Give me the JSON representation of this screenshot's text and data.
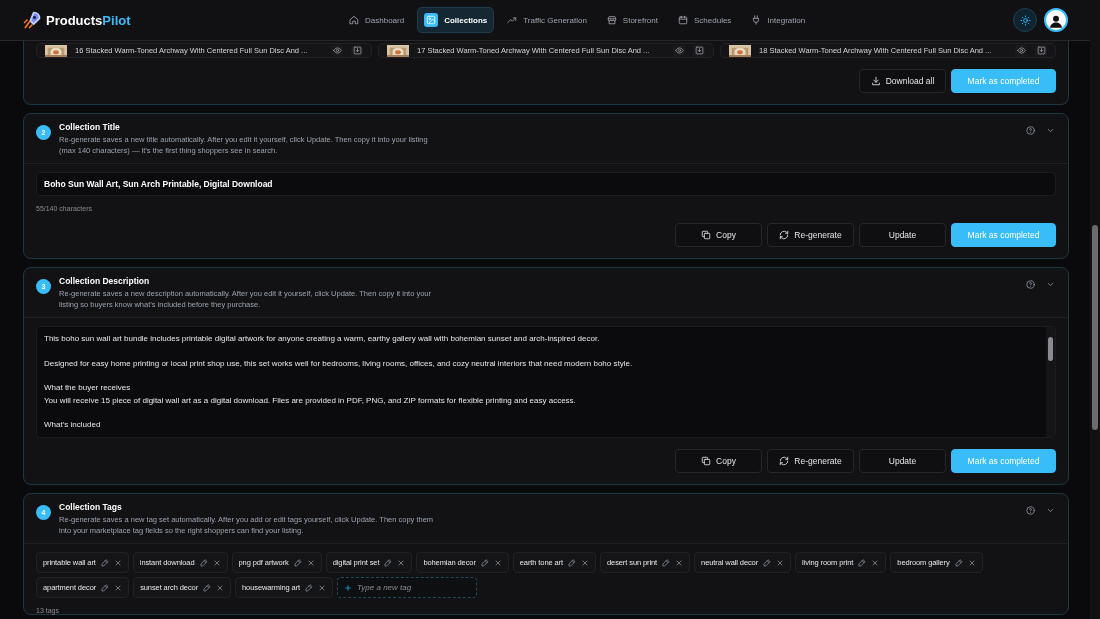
{
  "header": {
    "logo": {
      "name": "Products",
      "accent": "Pilot"
    },
    "nav": [
      {
        "label": "Dashboard",
        "selected": false
      },
      {
        "label": "Collections",
        "selected": true
      },
      {
        "label": "Traffic Generation",
        "selected": false
      },
      {
        "label": "Storefront",
        "selected": false
      },
      {
        "label": "Schedules",
        "selected": false
      },
      {
        "label": "Integration",
        "selected": false
      }
    ]
  },
  "downloads": {
    "files": [
      {
        "name": "16 Stacked Warm-Toned Archway With Centered Full Sun Disc And ..."
      },
      {
        "name": "17 Stacked Warm-Toned Archway With Centered Full Sun Disc And ..."
      },
      {
        "name": "18 Stacked Warm-Toned Archway With Centered Full Sun Disc And ..."
      }
    ],
    "buttons": [
      {
        "label": "Download all",
        "kind": "download"
      },
      {
        "label": "Mark as completed",
        "kind": "primary"
      }
    ]
  },
  "sections": [
    {
      "kind": "title",
      "number": "2",
      "title": "Collection Title",
      "hint": "Re-generate saves a new title automatically. After you edit it yourself, click Update. Then copy it into your listing (max 140 characters) — it’s the first thing shoppers see in search.",
      "value": "Boho Sun Wall Art, Sun Arch Printable, Digital Download",
      "counter": "55/140 characters",
      "buttons": [
        {
          "label": "Copy",
          "kind": "copy"
        },
        {
          "label": "Re-generate",
          "kind": "regenerate"
        },
        {
          "label": "Update",
          "kind": "plain"
        },
        {
          "label": "Mark as completed",
          "kind": "primary"
        }
      ]
    },
    {
      "kind": "description",
      "number": "3",
      "title": "Collection Description",
      "hint": "Re-generate saves a new description automatically. After you edit it yourself, click Update. Then copy it into your listing so buyers know what’s included before they purchase.",
      "paragraphs": [
        "This boho sun wall art bundle includes printable digital artwork for anyone creating a warm, earthy gallery wall with bohemian sunset and arch-inspired decor.",
        "Designed for easy home printing or local print shop use, this set works well for bedrooms, living rooms, offices, and cozy neutral interiors that need modern boho style.",
        "What the buyer receives\nYou will receive 15 piece of digital wall art as a digital download. Files are provided in PDF, PNG, and ZIP formats for flexible printing and easy access.",
        "What’s included"
      ],
      "buttons": [
        {
          "label": "Copy",
          "kind": "copy"
        },
        {
          "label": "Re-generate",
          "kind": "regenerate"
        },
        {
          "label": "Update",
          "kind": "plain"
        },
        {
          "label": "Mark as completed",
          "kind": "primary"
        }
      ]
    },
    {
      "kind": "tags",
      "number": "4",
      "title": "Collection Tags",
      "hint": "Re-generate saves a new tag set automatically. After you add or edit tags yourself, click Update. Then copy them into your marketplace tag fields so the right shoppers can find your listing.",
      "tags": [
        "printable wall art",
        "instant download",
        "png pdf artwork",
        "digital print set",
        "bohemian decor",
        "earth tone art",
        "desert sun print",
        "neutral wall decor",
        "living room print",
        "bedroom gallery",
        "apartment decor",
        "sunset arch decor",
        "housewarming art"
      ],
      "placeholder": "Type a new tag",
      "counter": "13 tags"
    }
  ]
}
